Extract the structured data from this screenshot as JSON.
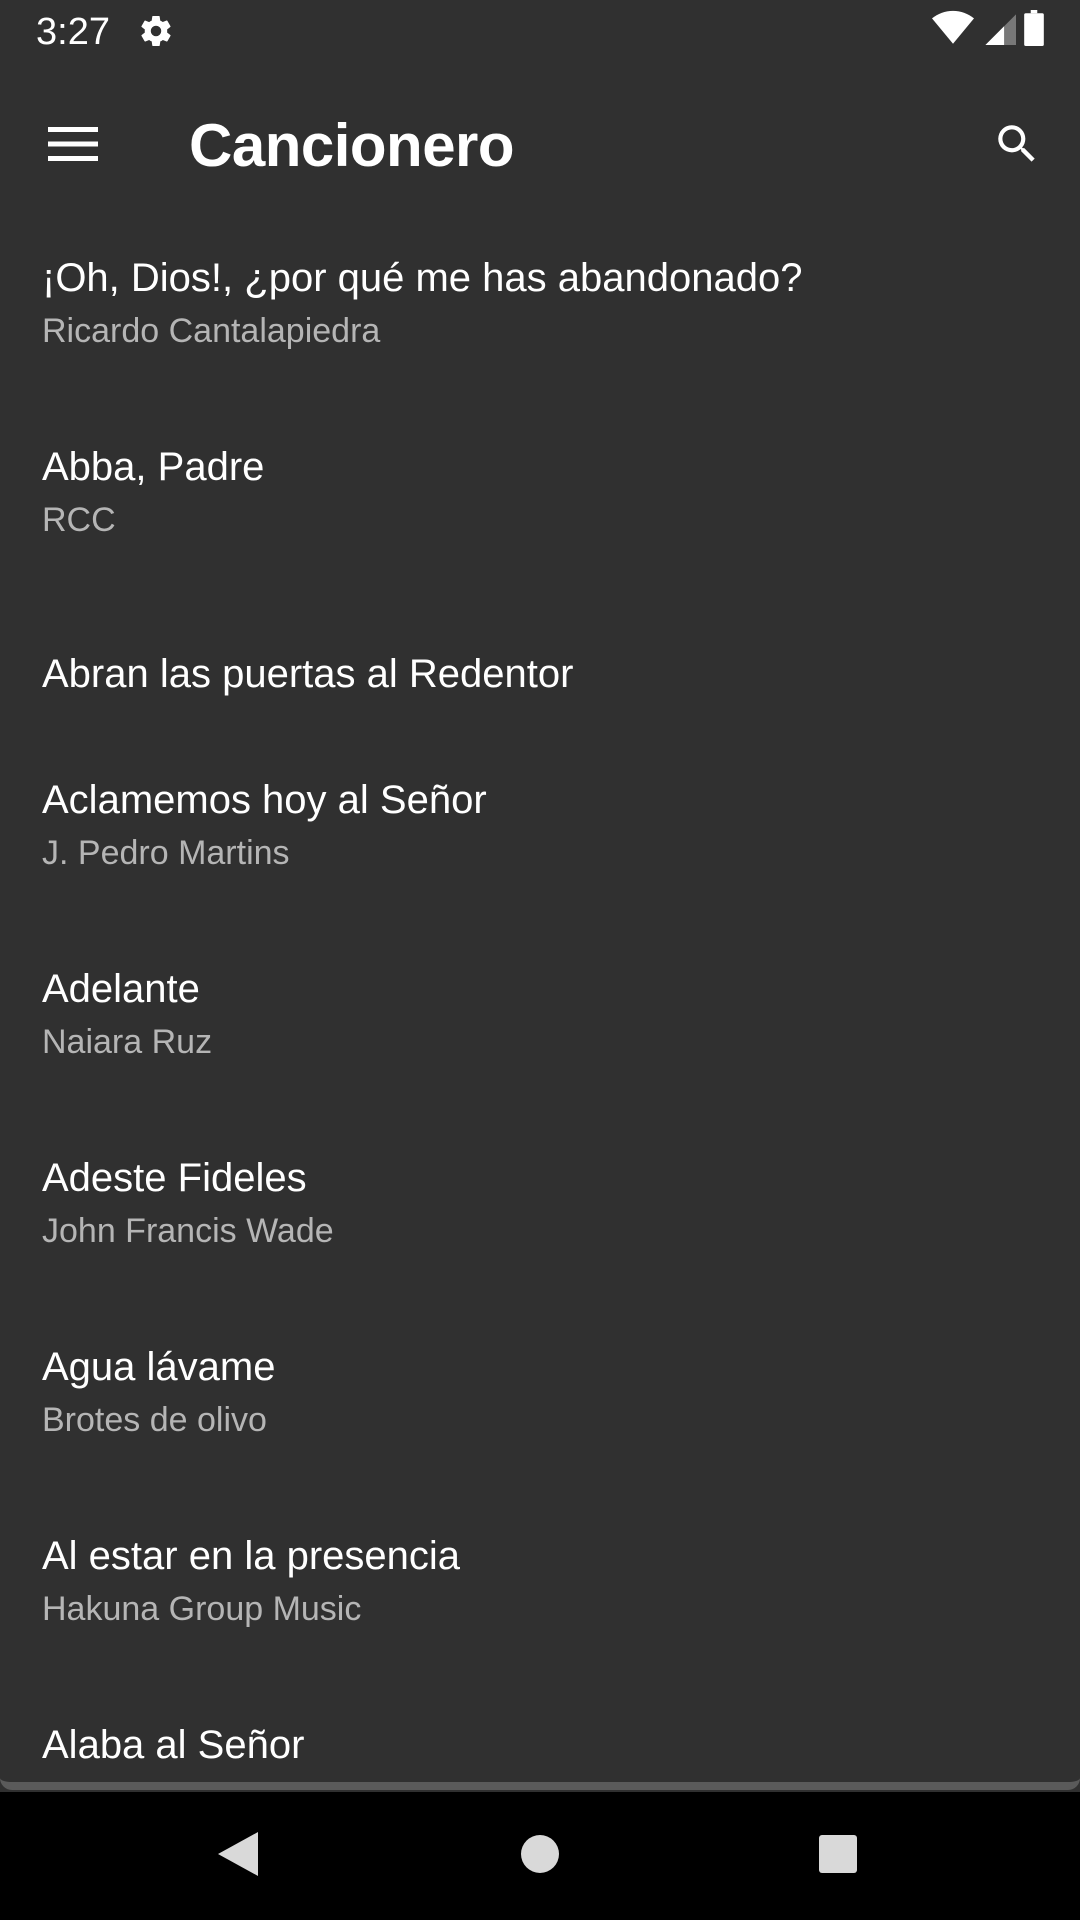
{
  "status_bar": {
    "time": "3:27",
    "icons": [
      "gear-icon",
      "wifi-icon",
      "cell-signal-icon",
      "battery-icon"
    ]
  },
  "app_bar": {
    "title": "Cancionero",
    "menu_icon": "hamburger-menu-icon",
    "search_icon": "search-icon"
  },
  "songs": [
    {
      "title": "¡Oh, Dios!, ¿por qué me has abandonado?",
      "author": "Ricardo Cantalapiedra"
    },
    {
      "title": "Abba, Padre",
      "author": "RCC"
    },
    {
      "title": "Abran las puertas al Redentor",
      "author": ""
    },
    {
      "title": "Aclamemos hoy al Señor",
      "author": "J. Pedro Martins"
    },
    {
      "title": "Adelante",
      "author": "Naiara Ruz"
    },
    {
      "title": "Adeste Fideles",
      "author": "John Francis Wade"
    },
    {
      "title": "Agua lávame",
      "author": "Brotes de olivo"
    },
    {
      "title": "Al estar en la presencia",
      "author": "Hakuna Group Music"
    },
    {
      "title": "Alaba al Señor",
      "author": ""
    }
  ],
  "nav_bar": {
    "icons": [
      "back-triangle-icon",
      "home-circle-icon",
      "recents-square-icon"
    ]
  },
  "colors": {
    "background": "#303030",
    "primary_text": "#ffffff",
    "secondary_text": "#b5b5b5",
    "nav_background": "#000000"
  }
}
